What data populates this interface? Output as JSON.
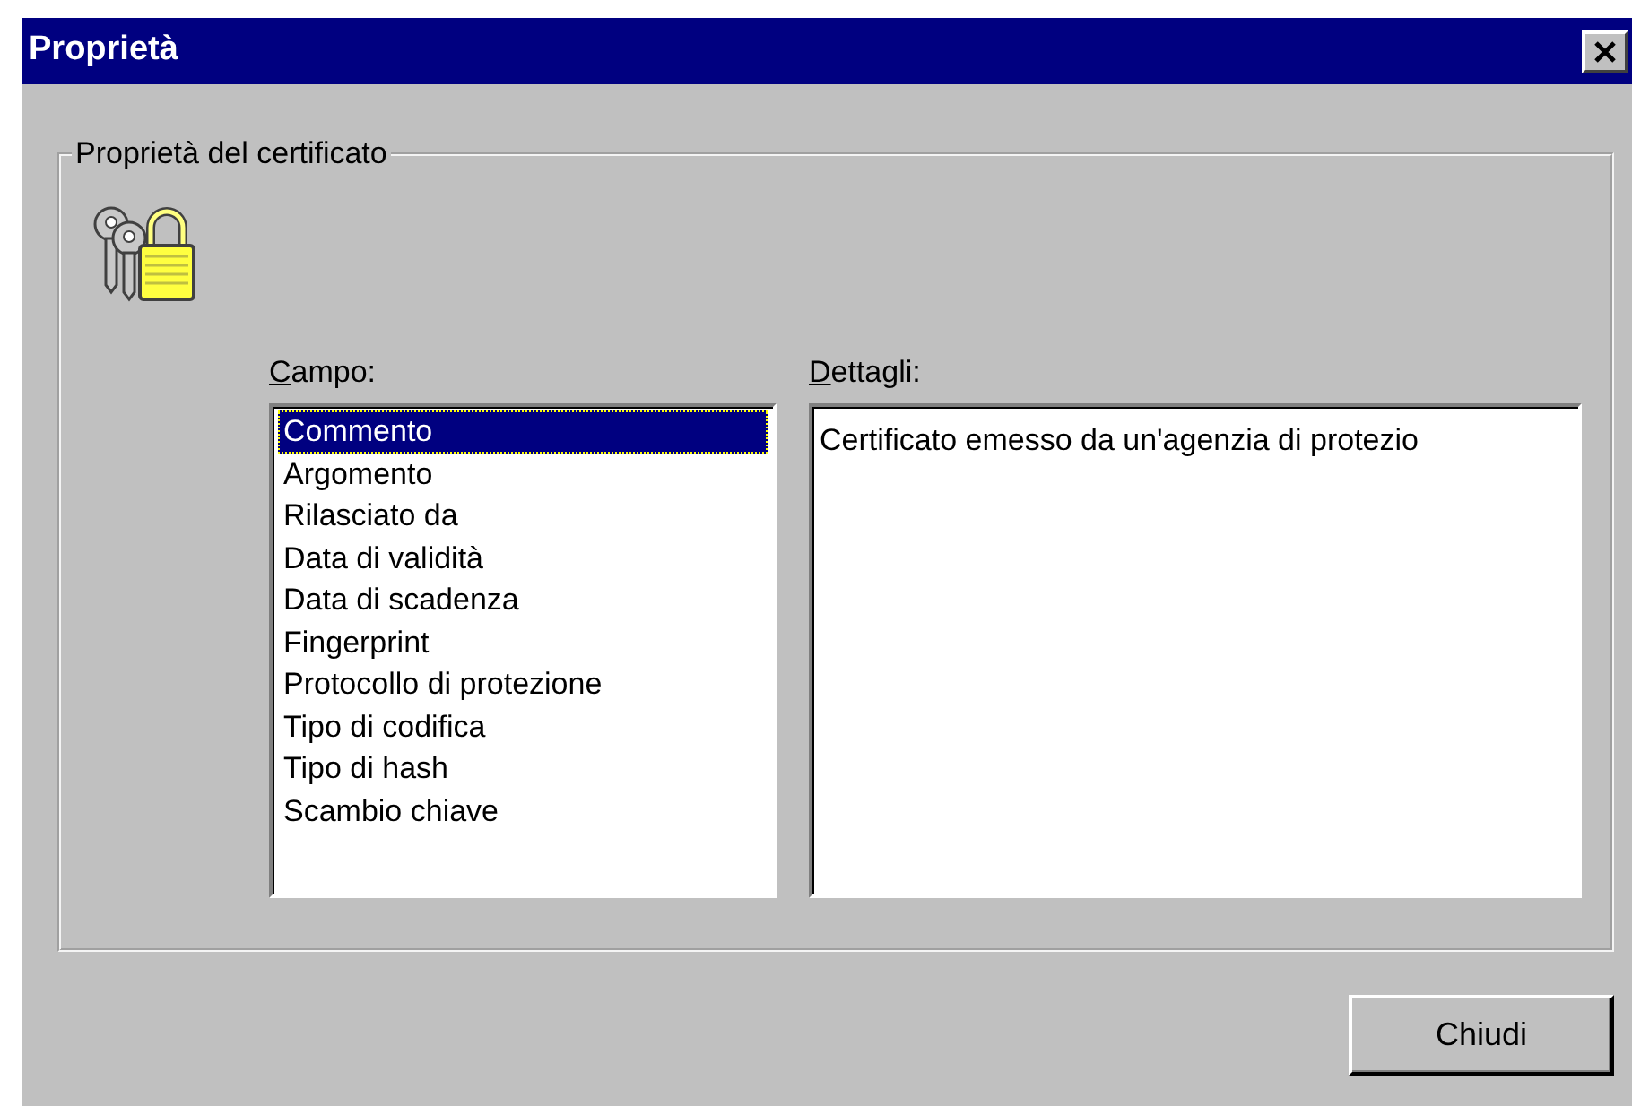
{
  "window": {
    "title": "Proprietà"
  },
  "group": {
    "title": "Proprietà del certificato"
  },
  "field_list": {
    "label": "Campo:",
    "items": [
      {
        "text": "Commento",
        "selected": true
      },
      {
        "text": "Argomento",
        "selected": false
      },
      {
        "text": "Rilasciato da",
        "selected": false
      },
      {
        "text": "Data di validità",
        "selected": false
      },
      {
        "text": "Data di scadenza",
        "selected": false
      },
      {
        "text": "Fingerprint",
        "selected": false
      },
      {
        "text": "Protocollo di protezione",
        "selected": false
      },
      {
        "text": "Tipo di codifica",
        "selected": false
      },
      {
        "text": "Tipo di hash",
        "selected": false
      },
      {
        "text": "Scambio chiave",
        "selected": false
      }
    ]
  },
  "details": {
    "label": "Dettagli:",
    "value": "Certificato emesso da un'agenzia di protezio"
  },
  "buttons": [
    "Chiudi"
  ]
}
